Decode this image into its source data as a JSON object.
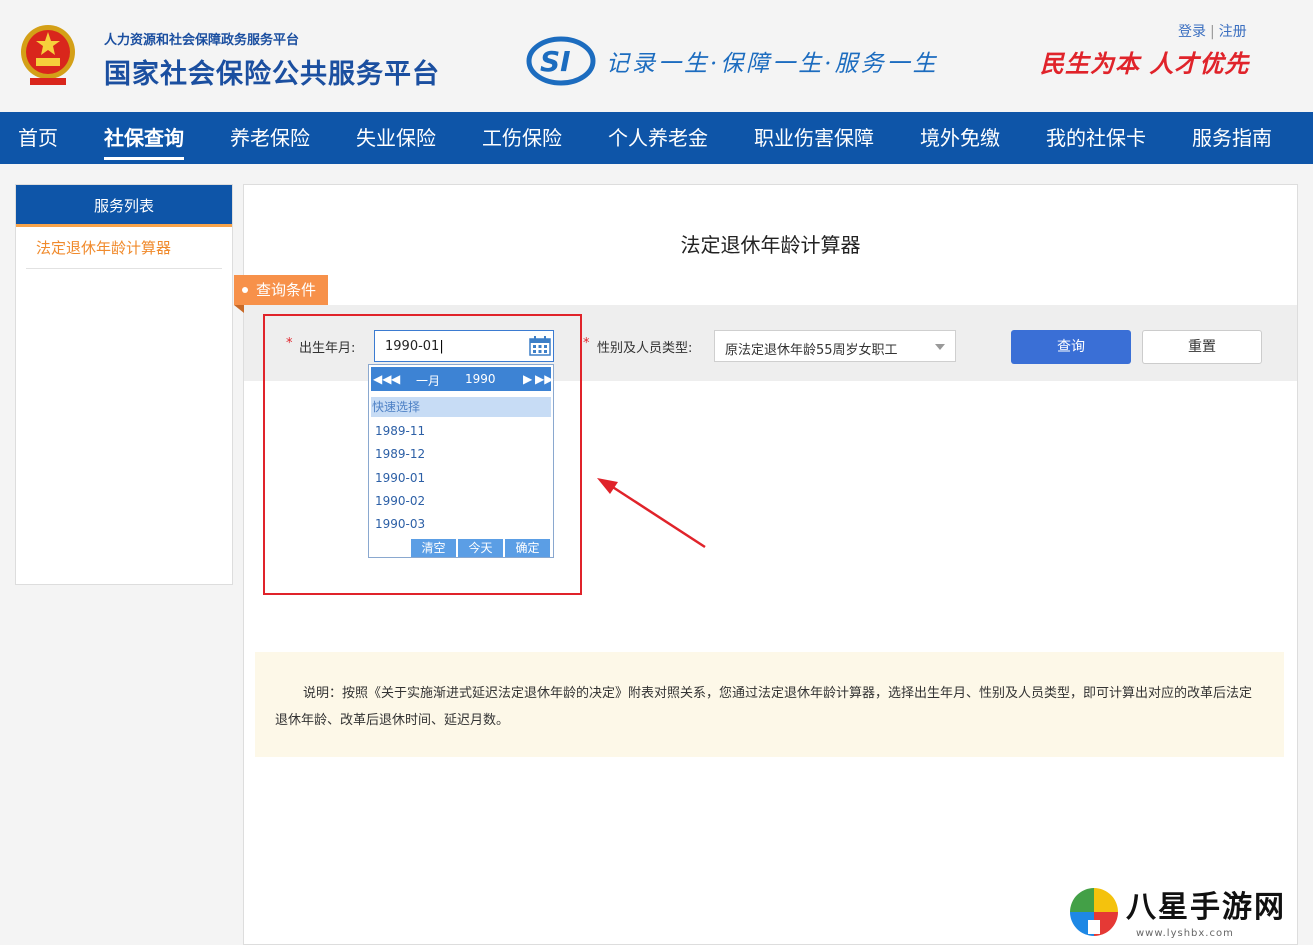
{
  "header": {
    "subtitle": "人力资源和社会保障政务服务平台",
    "title": "国家社会保险公共服务平台",
    "slogan": "记录一生·保障一生·服务一生",
    "motto": "民生为本 人才优先",
    "login": "登录",
    "register": "注册",
    "si_logo_text": "SI"
  },
  "nav": {
    "items": [
      {
        "label": "首页"
      },
      {
        "label": "社保查询",
        "active": true
      },
      {
        "label": "养老保险"
      },
      {
        "label": "失业保险"
      },
      {
        "label": "工伤保险"
      },
      {
        "label": "个人养老金"
      },
      {
        "label": "职业伤害保障"
      },
      {
        "label": "境外免缴"
      },
      {
        "label": "我的社保卡"
      },
      {
        "label": "服务指南"
      }
    ]
  },
  "sidebar": {
    "heading": "服务列表",
    "items": [
      {
        "label": "法定退休年龄计算器"
      }
    ]
  },
  "main": {
    "title": "法定退休年龄计算器",
    "query_tag": "查询条件",
    "required_mark": "*",
    "birth_label": "出生年月:",
    "birth_value": "1990-01",
    "type_label": "性别及人员类型:",
    "type_value": "原法定退休年龄55周岁女职工",
    "query_button": "查询",
    "reset_button": "重置"
  },
  "datepicker": {
    "month": "一月",
    "year": "1990",
    "quick_label": "快速选择",
    "options": [
      "1989-11",
      "1989-12",
      "1990-01",
      "1990-02",
      "1990-03"
    ],
    "clear": "清空",
    "today": "今天",
    "confirm": "确定"
  },
  "note": {
    "text": "说明：按照《关于实施渐进式延迟法定退休年龄的决定》附表对照关系，您通过法定退休年龄计算器，选择出生年月、性别及人员类型，即可计算出对应的改革后法定退休年龄、改革后退休时间、延迟月数。"
  },
  "watermark": {
    "text": "八星手游网",
    "url": "www.lyshbx.com"
  },
  "colors": {
    "nav_blue": "#0e55a8",
    "accent_orange": "#f7914a",
    "annotation_red": "#e0232a",
    "button_blue": "#3a6fd6"
  }
}
